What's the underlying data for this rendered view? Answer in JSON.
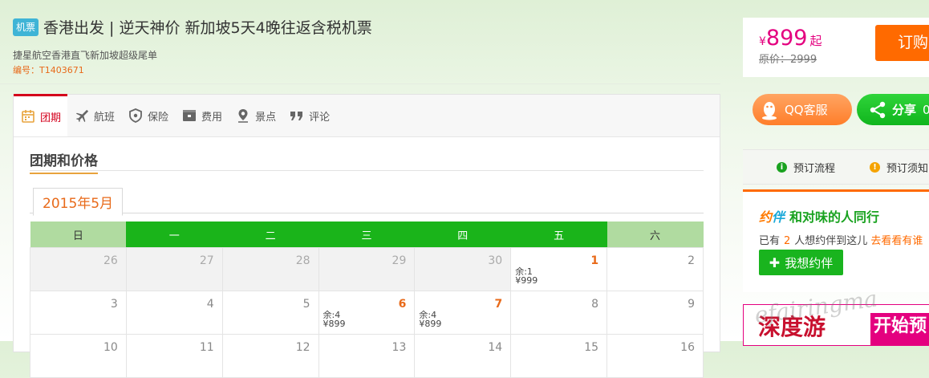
{
  "header": {
    "badge": "机票",
    "title": "香港出发 | 逆天神价 新加坡5天4晚往返含税机票",
    "subtitle": "捷星航空香港直飞新加坡超级尾单",
    "code": "编号：T1403671"
  },
  "tabs": [
    {
      "label": "团期",
      "icon": "calendar-icon"
    },
    {
      "label": "航班",
      "icon": "plane-icon"
    },
    {
      "label": "保险",
      "icon": "shield-icon"
    },
    {
      "label": "费用",
      "icon": "wallet-icon"
    },
    {
      "label": "景点",
      "icon": "location-pin-icon"
    },
    {
      "label": "评论",
      "icon": "quote-icon"
    }
  ],
  "section": {
    "title": "团期和价格",
    "month": "2015年5月"
  },
  "calendar": {
    "weekdays": [
      "日",
      "一",
      "二",
      "三",
      "四",
      "五",
      "六"
    ],
    "rows": [
      [
        {
          "day": "26",
          "other": true
        },
        {
          "day": "27",
          "other": true
        },
        {
          "day": "28",
          "other": true
        },
        {
          "day": "29",
          "other": true
        },
        {
          "day": "30",
          "other": true
        },
        {
          "day": "1",
          "remain": "余:1",
          "price": "¥999"
        },
        {
          "day": "2"
        }
      ],
      [
        {
          "day": "3"
        },
        {
          "day": "4"
        },
        {
          "day": "5"
        },
        {
          "day": "6",
          "remain": "余:4",
          "price": "¥899"
        },
        {
          "day": "7",
          "remain": "余:4",
          "price": "¥899"
        },
        {
          "day": "8"
        },
        {
          "day": "9"
        }
      ],
      [
        {
          "day": "10"
        },
        {
          "day": "11"
        },
        {
          "day": "12"
        },
        {
          "day": "13"
        },
        {
          "day": "14"
        },
        {
          "day": "15"
        },
        {
          "day": "16"
        }
      ]
    ]
  },
  "price_box": {
    "currency": "¥",
    "price": "899",
    "suffix": "起",
    "original": "原价：2999",
    "order_label": "订购"
  },
  "social": {
    "qq_label": "QQ客服",
    "share_label": "分享",
    "share_count": "0"
  },
  "process": {
    "item1": "预订流程",
    "item2": "预订须知"
  },
  "companion": {
    "logo_a": "约",
    "logo_b": "伴",
    "title": "和对味的人同行",
    "line_prefix": "已有",
    "count": "2",
    "line_suffix": "人想约伴到这儿",
    "link": "去看看有谁",
    "button": "我想约伴"
  },
  "banner": {
    "left_text": "深度游",
    "right_text": "开始预"
  },
  "watermark": "efairingma",
  "colors": {
    "accent_green": "#1ab41a",
    "accent_orange": "#ff6a00",
    "price_pink": "#e4007f",
    "active_tab_red": "#d4001c"
  }
}
